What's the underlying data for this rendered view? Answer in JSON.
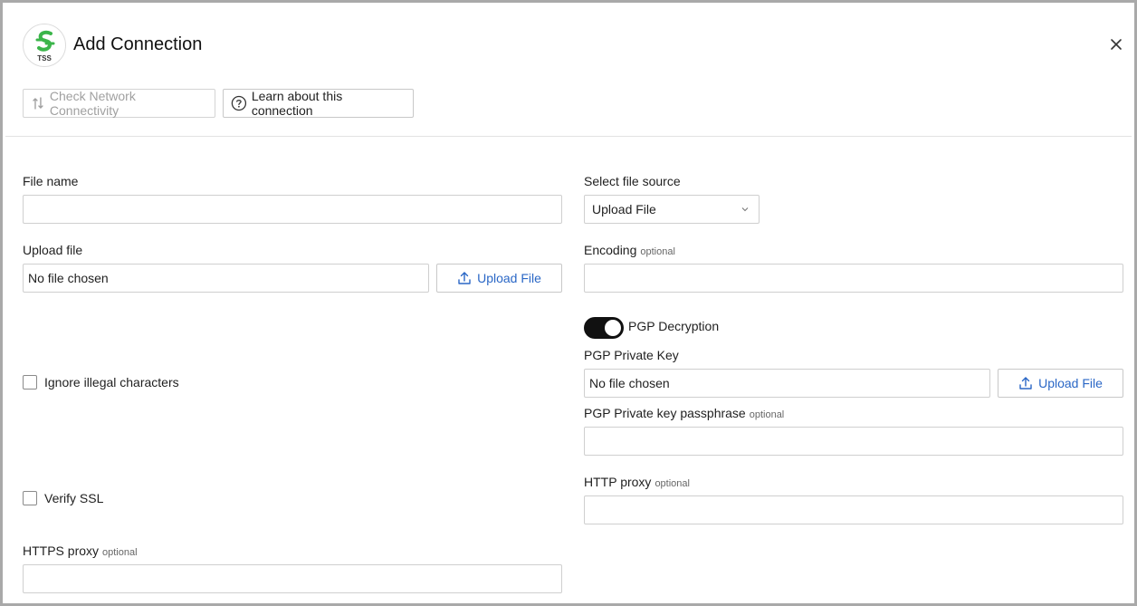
{
  "header": {
    "logo_text": "TSS",
    "title": "Add Connection"
  },
  "toolbar": {
    "check_label": "Check Network Connectivity",
    "learn_label": "Learn about this connection"
  },
  "form": {
    "file_name": {
      "label": "File name",
      "value": ""
    },
    "file_source": {
      "label": "Select file source",
      "selected": "Upload File"
    },
    "upload_file": {
      "label": "Upload file",
      "value": "No file chosen",
      "button": "Upload File"
    },
    "encoding": {
      "label": "Encoding",
      "optional": "optional",
      "value": ""
    },
    "pgp_decryption": {
      "label": "PGP Decryption",
      "enabled": true
    },
    "ignore_illegal": {
      "label": "Ignore illegal characters",
      "checked": false
    },
    "pgp_private_key": {
      "label": "PGP Private Key",
      "value": "No file chosen",
      "button": "Upload File"
    },
    "pgp_passphrase": {
      "label": "PGP Private key passphrase",
      "optional": "optional",
      "value": ""
    },
    "verify_ssl": {
      "label": "Verify SSL",
      "checked": false
    },
    "http_proxy": {
      "label": "HTTP proxy",
      "optional": "optional",
      "value": ""
    },
    "https_proxy": {
      "label": "HTTPS proxy",
      "optional": "optional",
      "value": ""
    }
  },
  "colors": {
    "logo_green": "#3bb54a",
    "link_blue": "#2a67c6",
    "toggle_on": "#111111"
  }
}
